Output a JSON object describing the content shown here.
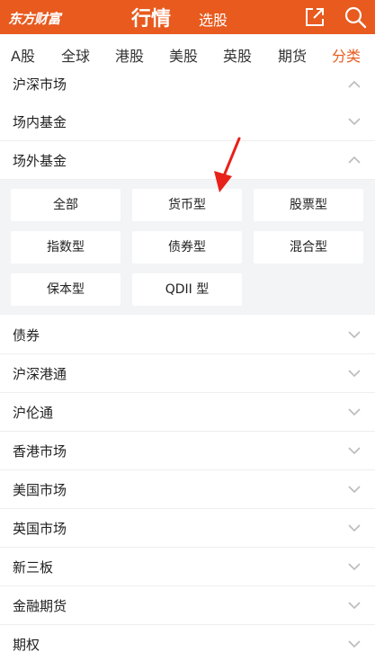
{
  "header": {
    "logo_text": "东方财富",
    "title": "行情",
    "subtitle": "选股",
    "share_icon": "share-icon",
    "search_icon": "search-icon",
    "bg_color": "#e85a1e"
  },
  "tabs": {
    "items": [
      {
        "label": "A股"
      },
      {
        "label": "全球"
      },
      {
        "label": "港股"
      },
      {
        "label": "美股"
      },
      {
        "label": "英股"
      },
      {
        "label": "期货"
      },
      {
        "label": "分类"
      }
    ],
    "active_index": 6,
    "accent_color": "#e85a1e"
  },
  "categories": [
    {
      "label": "沪深市场",
      "state": "expanded-partial"
    },
    {
      "label": "场内基金",
      "state": "collapsed"
    },
    {
      "label": "场外基金",
      "state": "expanded"
    },
    {
      "label": "债券",
      "state": "collapsed"
    },
    {
      "label": "沪深港通",
      "state": "collapsed"
    },
    {
      "label": "沪伦通",
      "state": "collapsed"
    },
    {
      "label": "香港市场",
      "state": "collapsed"
    },
    {
      "label": "美国市场",
      "state": "collapsed"
    },
    {
      "label": "英国市场",
      "state": "collapsed"
    },
    {
      "label": "新三板",
      "state": "collapsed"
    },
    {
      "label": "金融期货",
      "state": "collapsed"
    },
    {
      "label": "期权",
      "state": "collapsed"
    }
  ],
  "fund_types": [
    {
      "label": "全部"
    },
    {
      "label": "货币型"
    },
    {
      "label": "股票型"
    },
    {
      "label": "指数型"
    },
    {
      "label": "债券型"
    },
    {
      "label": "混合型"
    },
    {
      "label": "保本型"
    },
    {
      "label": "QDII 型"
    }
  ],
  "annotation": {
    "arrow_color": "#e8211a"
  }
}
